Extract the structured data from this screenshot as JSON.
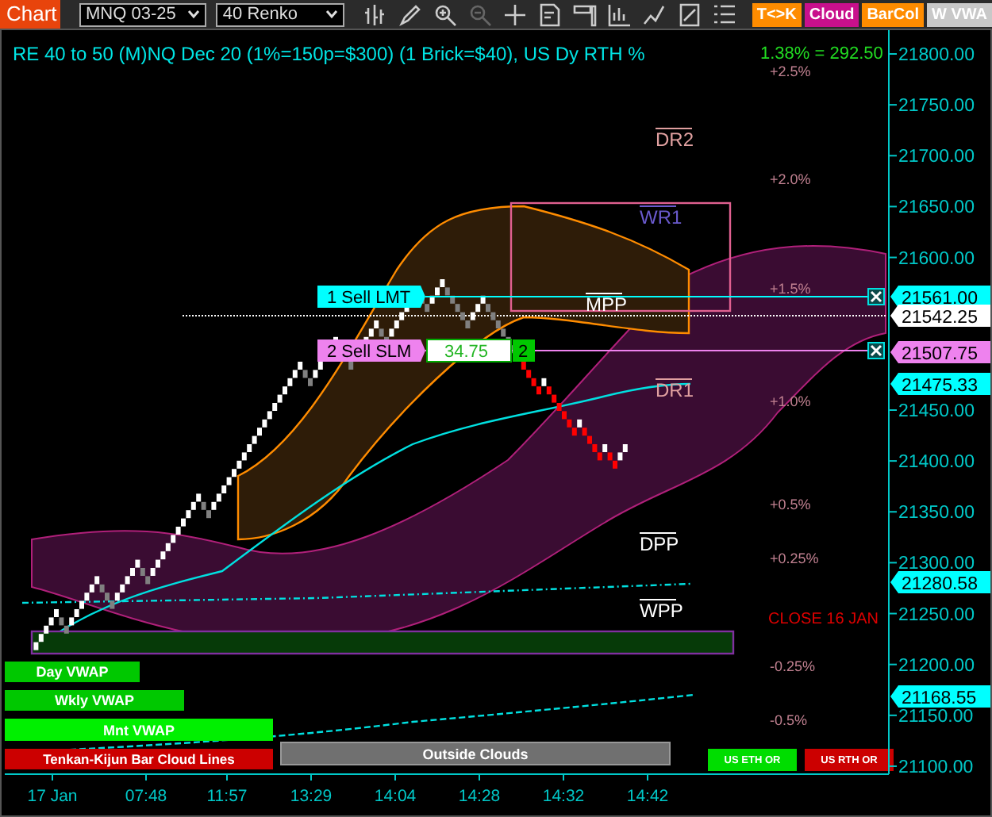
{
  "toolbar": {
    "chart_button": "Chart",
    "instrument": "MNQ 03-25",
    "period": "40 Renko",
    "toggles": [
      {
        "label": "T<>K",
        "color": "#ff8c00"
      },
      {
        "label": "Cloud",
        "color": "#c8108c"
      },
      {
        "label": "BarCol",
        "color": "#ff8c00"
      },
      {
        "label": "W VWA",
        "color": "#c8c8c8"
      }
    ]
  },
  "chart": {
    "title": "RE 40 to 50 (M)NQ Dec 20 (1%=150p=$300) (1 Brick=$40), US Dy RTH %",
    "change": "1.38% = 292.50",
    "price_axis": [
      "21800.00",
      "21750.00",
      "21700.00",
      "21650.00",
      "21600.00",
      "21450.00",
      "21400.00",
      "21350.00",
      "21300.00",
      "21250.00",
      "21200.00",
      "21150.00",
      "21100.00"
    ],
    "price_markers": [
      {
        "label": "21561.00",
        "color": "#00ffff"
      },
      {
        "label": "21542.25",
        "color": "#ffffff"
      },
      {
        "label": "21507.75",
        "color": "#ee82ee"
      },
      {
        "label": "21475.33",
        "color": "#00ffff"
      },
      {
        "label": "21280.58",
        "color": "#00ffff"
      },
      {
        "label": "21168.55",
        "color": "#00ffff"
      }
    ],
    "percent_labels": [
      "+2.5%",
      "+2.0%",
      "+1.5%",
      "+1.0%",
      "+0.5%",
      "+0.25%",
      "-0.25%",
      "-0.5%"
    ],
    "pivot_labels": [
      {
        "label": "DR2",
        "color": "#e0a0a0"
      },
      {
        "label": "WR1",
        "color": "#6a5acd"
      },
      {
        "label": "MPP",
        "color": "#ffffff"
      },
      {
        "label": "DR1",
        "color": "#e0a0a0"
      },
      {
        "label": "DPP",
        "color": "#ffffff"
      },
      {
        "label": "WPP",
        "color": "#ffffff"
      }
    ],
    "close_label": "CLOSE 16 JAN",
    "orders": [
      {
        "label": "1 Sell LMT",
        "color": "#00ffff"
      },
      {
        "label": "2 Sell SLM",
        "color": "#ee82ee",
        "price": "34.75",
        "quantity": "2"
      }
    ],
    "indicator_labels": [
      {
        "label": "Day VWAP",
        "color": "#00c800"
      },
      {
        "label": "Wkly VWAP",
        "color": "#00c800"
      },
      {
        "label": "Mnt VWAP",
        "color": "#00f000"
      },
      {
        "label": "Tenkan-Kijun Bar Cloud Lines",
        "color": "#cc0000"
      },
      {
        "label": "Outside Clouds",
        "color": "#707070"
      },
      {
        "label": "US ETH OR",
        "color": "#00dd00"
      },
      {
        "label": "US RTH OR",
        "color": "#cc0000"
      }
    ],
    "time_axis": [
      "17 Jan",
      "07:48",
      "11:57",
      "13:29",
      "14:04",
      "14:28",
      "14:32",
      "14:42"
    ]
  }
}
